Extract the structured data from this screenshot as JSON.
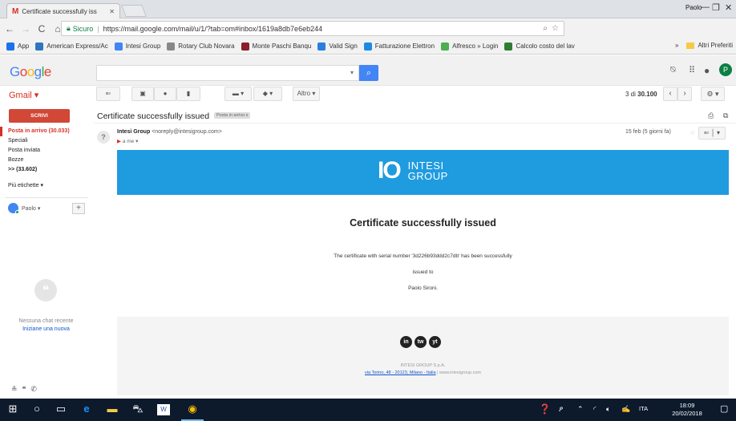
{
  "browser": {
    "tab_title": "Certificate successfully iss",
    "tab_favicon": "gmail-icon",
    "window_user": "Paolo",
    "address": {
      "secure_label": "Sicuro",
      "url": "https://mail.google.com/mail/u/1/?tab=om#inbox/1619a8db7e6eb244"
    },
    "bookmarks": [
      {
        "label": "App",
        "icon": "apps-icon",
        "color": "#1a73e8"
      },
      {
        "label": "American Express/Ac",
        "icon": "amex-icon",
        "color": "#2e77bc"
      },
      {
        "label": "Intesi Group",
        "icon": "google-icon",
        "color": "#4285f4"
      },
      {
        "label": "Rotary Club Novara",
        "icon": "page-icon",
        "color": "#888888"
      },
      {
        "label": "Monte Paschi Banqu",
        "icon": "mps-icon",
        "color": "#8b1d2c"
      },
      {
        "label": "Valid Sign",
        "icon": "check-icon",
        "color": "#2a7de1"
      },
      {
        "label": "Fatturazione Elettron",
        "icon": "circle-icon",
        "color": "#1e88e5"
      },
      {
        "label": "Alfresco » Login",
        "icon": "alfresco-icon",
        "color": "#4caf50"
      },
      {
        "label": "Calcolo costo del lav",
        "icon": "search-icon",
        "color": "#2e7d32"
      }
    ],
    "bookmarks_more": "»",
    "other_bookmarks": "Altri Preferiti"
  },
  "gmail": {
    "logo": "Google",
    "app_label": "Gmail ▾",
    "compose": "SCRIVI",
    "toolbar": {
      "more": "Altro ▾"
    },
    "pager": {
      "prefix": "3 di ",
      "total": "30.100"
    },
    "account_initial": "P",
    "sidebar": [
      {
        "label": "Posta in arrivo (30.033)",
        "state": "active"
      },
      {
        "label": "Speciali",
        "state": "normal"
      },
      {
        "label": "Posta inviata",
        "state": "normal"
      },
      {
        "label": "Bozze",
        "state": "normal"
      },
      {
        "label": ">> (33.602)",
        "state": "bold"
      },
      {
        "label": "Più etichette ▾",
        "state": "normal"
      }
    ],
    "chat": {
      "user": "Paolo ▾",
      "no_chat": "Nessuna chat recente",
      "start_new": "Iniziane una nuova"
    }
  },
  "message": {
    "subject": "Certificate successfully issued",
    "label_badge": "Posta in arrivo x",
    "sender_name": "Intesi Group",
    "sender_email": "<noreply@intesigroup.com>",
    "to": "a me",
    "date": "15 feb (5 giorni fa)",
    "body": {
      "logo_io": "IO",
      "logo_line1": "INTESI",
      "logo_line2": "GROUP",
      "title": "Certificate successfully issued",
      "line1": "The certificate with serial number '3d226b93ddd2c7db' has been successfully",
      "line2": "issued to",
      "line3": "Paolo Sironi.",
      "footer_company": "INTESI GROUP S.p.A.",
      "footer_address": "via Torino, 48 - 20123, Milano - Italia",
      "footer_sep": " | ",
      "footer_web": "www.intesigroup.com",
      "social": [
        "in",
        "tw",
        "yt"
      ]
    }
  },
  "taskbar": {
    "language": "ITA",
    "time": "18:09",
    "date": "20/02/2018"
  },
  "colors": {
    "banner": "#1f9be0",
    "compose": "#d14836",
    "gmail_red": "#d93025",
    "taskbar": "#0c1a2c"
  }
}
